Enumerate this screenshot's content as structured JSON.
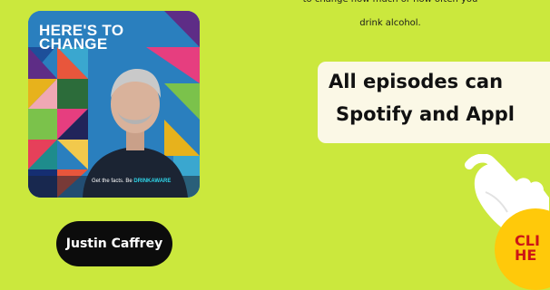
{
  "cover": {
    "title_line1": "HERE'S TO",
    "title_line2": "CHANGE",
    "tagline": "Get the facts. Be",
    "brand": "DRINKAWARE"
  },
  "host": {
    "name": "Justin Caffrey"
  },
  "intro": {
    "line1": "to change how much or how often you",
    "line2": "drink alcohol."
  },
  "episodes": {
    "line1": "All episodes can",
    "line2": "Spotify and Appl"
  },
  "cta": {
    "line1": "CLI",
    "line2": "HE"
  },
  "colors": {
    "background": "#cbe83d",
    "pill": "#0c0c0c",
    "cta": "#ffc90a",
    "cta_text": "#cc1616"
  }
}
